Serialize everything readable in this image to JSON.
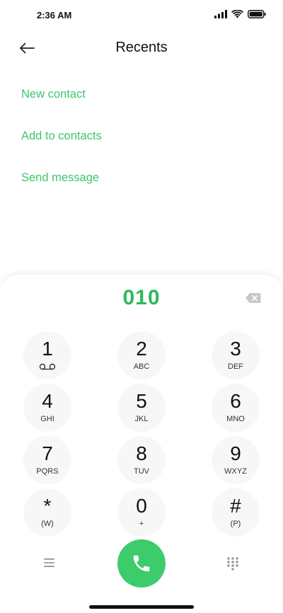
{
  "status_bar": {
    "time": "2:36 AM",
    "icons": [
      "signal-icon",
      "wifi-icon",
      "battery-icon"
    ]
  },
  "header": {
    "title": "Recents",
    "back_icon": "back-arrow-icon"
  },
  "actions": [
    {
      "label": "New contact"
    },
    {
      "label": "Add to contacts"
    },
    {
      "label": "Send message"
    }
  ],
  "dialer": {
    "number": "010",
    "keys": [
      {
        "digit": "1",
        "letters": ""
      },
      {
        "digit": "2",
        "letters": "ABC"
      },
      {
        "digit": "3",
        "letters": "DEF"
      },
      {
        "digit": "4",
        "letters": "GHI"
      },
      {
        "digit": "5",
        "letters": "JKL"
      },
      {
        "digit": "6",
        "letters": "MNO"
      },
      {
        "digit": "7",
        "letters": "PQRS"
      },
      {
        "digit": "8",
        "letters": "TUV"
      },
      {
        "digit": "9",
        "letters": "WXYZ"
      },
      {
        "digit": "*",
        "letters": "(W)"
      },
      {
        "digit": "0",
        "letters": "+"
      },
      {
        "digit": "#",
        "letters": "(P)"
      }
    ]
  },
  "colors": {
    "accent": "#3cc66b",
    "number": "#2fb85c",
    "call_button": "#3dcc6c",
    "key_background": "#f7f7f7"
  }
}
